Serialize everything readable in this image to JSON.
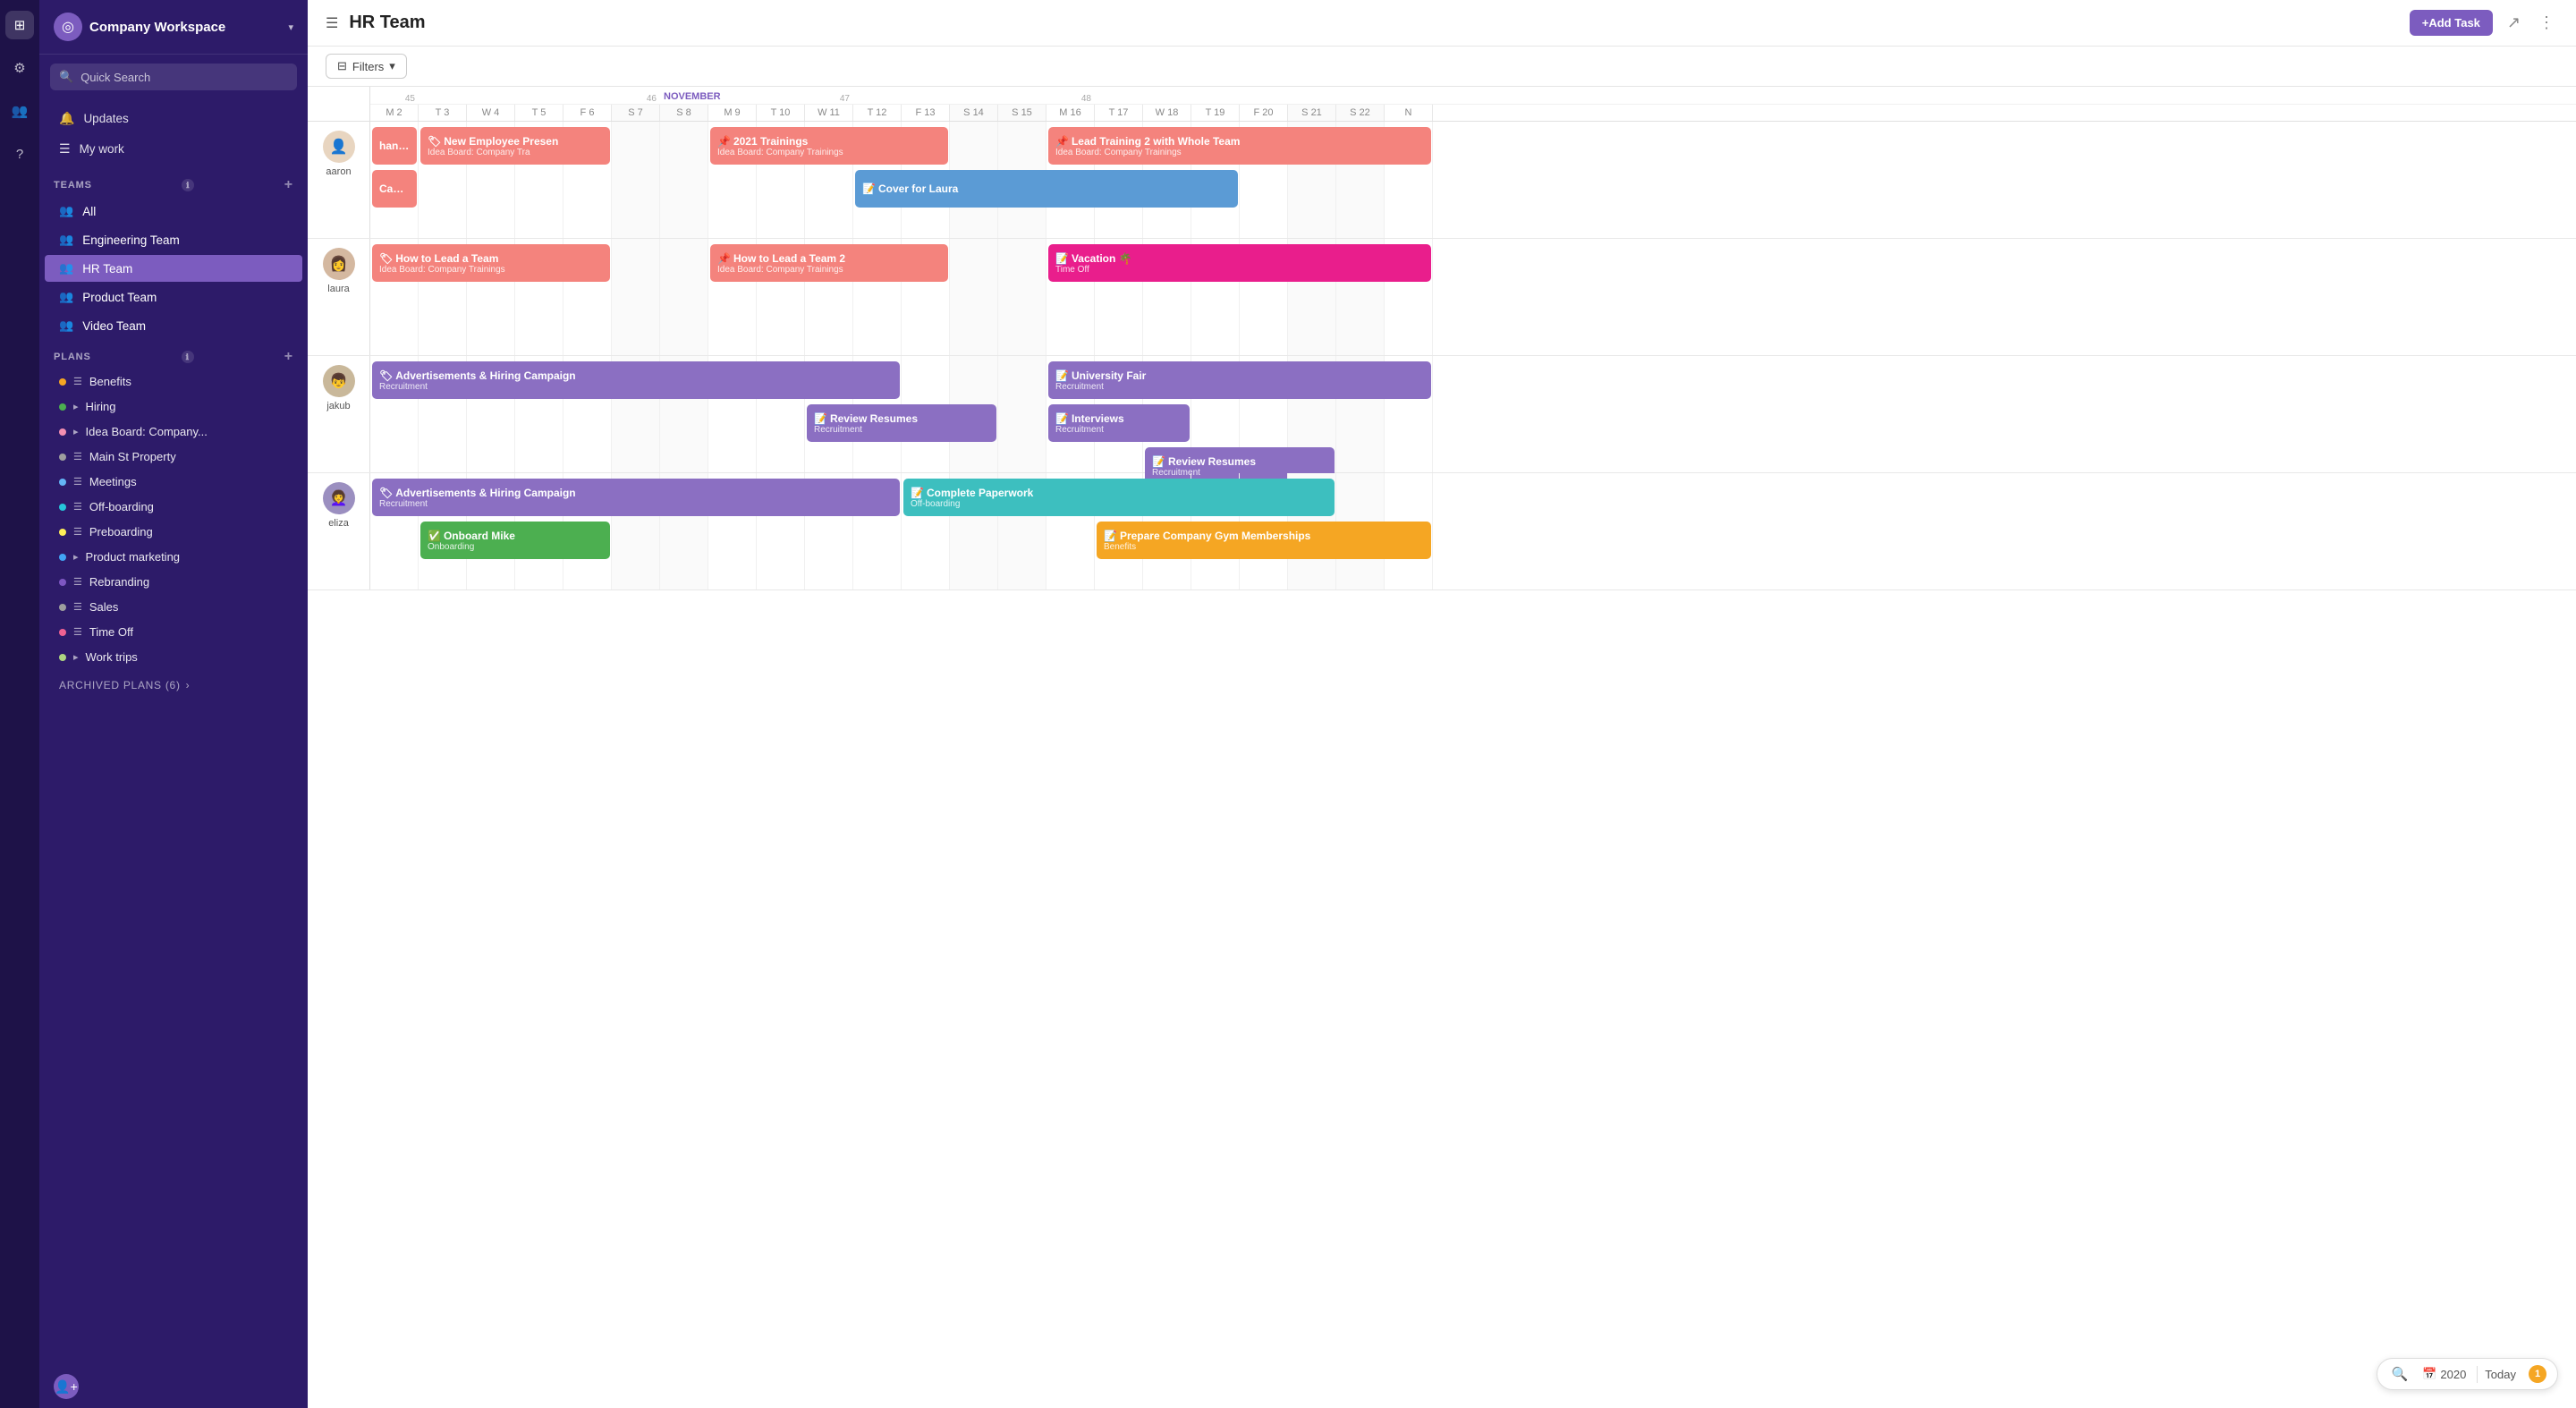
{
  "sidebar": {
    "workspace_label": "Company Workspace",
    "search_placeholder": "Quick Search",
    "nav_items": [
      {
        "id": "updates",
        "label": "Updates",
        "icon": "🔔"
      },
      {
        "id": "my-work",
        "label": "My work",
        "icon": "☰"
      }
    ],
    "teams_section": "TEAMS",
    "teams": [
      {
        "id": "all",
        "label": "All"
      },
      {
        "id": "engineering",
        "label": "Engineering Team"
      },
      {
        "id": "hr",
        "label": "HR Team",
        "active": true
      },
      {
        "id": "product",
        "label": "Product Team"
      },
      {
        "id": "video",
        "label": "Video Team"
      }
    ],
    "plans_section": "PLANS",
    "plans": [
      {
        "id": "benefits",
        "label": "Benefits",
        "dot_color": "#f5a623",
        "type": "rows"
      },
      {
        "id": "hiring",
        "label": "Hiring",
        "dot_color": "#4caf50",
        "type": "arrow"
      },
      {
        "id": "idea-board",
        "label": "Idea Board: Company...",
        "dot_color": "#f48fb1",
        "type": "arrow"
      },
      {
        "id": "main-st",
        "label": "Main St Property",
        "dot_color": "#9e9e9e",
        "type": "rows"
      },
      {
        "id": "meetings",
        "label": "Meetings",
        "dot_color": "#64b5f6",
        "type": "rows"
      },
      {
        "id": "offboarding",
        "label": "Off-boarding",
        "dot_color": "#26c6da",
        "type": "rows"
      },
      {
        "id": "preboarding",
        "label": "Preboarding",
        "dot_color": "#ffee58",
        "type": "rows"
      },
      {
        "id": "product-marketing",
        "label": "Product marketing",
        "dot_color": "#42a5f5",
        "type": "arrow"
      },
      {
        "id": "rebranding",
        "label": "Rebranding",
        "dot_color": "#7e57c2",
        "type": "rows"
      },
      {
        "id": "sales",
        "label": "Sales",
        "dot_color": "#9e9e9e",
        "type": "rows"
      },
      {
        "id": "time-off",
        "label": "Time Off",
        "dot_color": "#f06292",
        "type": "rows"
      },
      {
        "id": "work-trips",
        "label": "Work trips",
        "dot_color": "#aed581",
        "type": "arrow"
      }
    ],
    "archived_label": "ARCHIVED PLANS (6)"
  },
  "topbar": {
    "title": "HR Team",
    "add_btn_label": "+Add Task",
    "menu_icon": "☰",
    "share_icon": "↑",
    "more_icon": "⋮"
  },
  "filterbar": {
    "filter_btn_label": "Filters",
    "filter_icon": "▾"
  },
  "calendar": {
    "week_num_45": "45",
    "week_num_46": "46",
    "week_num_47": "47",
    "week_num_48": "48",
    "month_november": "NOVEMBER",
    "days": [
      {
        "label": "M 2",
        "col": 1
      },
      {
        "label": "T 3",
        "col": 2
      },
      {
        "label": "W 4",
        "col": 3
      },
      {
        "label": "T 5",
        "col": 4
      },
      {
        "label": "F 6",
        "col": 5
      },
      {
        "label": "S 7",
        "col": 6
      },
      {
        "label": "S 8",
        "col": 7
      },
      {
        "label": "M 9",
        "col": 8
      },
      {
        "label": "T 10",
        "col": 9
      },
      {
        "label": "W 11",
        "col": 10
      },
      {
        "label": "T 12",
        "col": 11
      },
      {
        "label": "F 13",
        "col": 12
      },
      {
        "label": "S 14",
        "col": 13
      },
      {
        "label": "S 15",
        "col": 14
      },
      {
        "label": "M 16",
        "col": 15
      },
      {
        "label": "T 17",
        "col": 16
      },
      {
        "label": "W 18",
        "col": 17
      },
      {
        "label": "T 19",
        "col": 18
      },
      {
        "label": "F 20",
        "col": 19
      },
      {
        "label": "S 21",
        "col": 20
      },
      {
        "label": "S 22",
        "col": 21
      },
      {
        "label": "N",
        "col": 22
      }
    ],
    "people": [
      {
        "id": "aaron",
        "name": "aaron",
        "avatar_emoji": "👤",
        "events": [
          {
            "id": "e1",
            "title": "handbook",
            "sub": "",
            "col_start": 1,
            "col_span": 1,
            "color": "ev-salmon",
            "icon": "",
            "row": 1
          },
          {
            "id": "e2",
            "title": "New Employee Presen",
            "sub": "Idea Board: Company Tra",
            "col_start": 2,
            "col_span": 4,
            "color": "ev-salmon",
            "icon": "🏷",
            "row": 1
          },
          {
            "id": "e3",
            "title": "2021 Trainings",
            "sub": "Idea Board: Company Trainings",
            "col_start": 8,
            "col_span": 5,
            "color": "ev-salmon",
            "icon": "📌",
            "row": 1
          },
          {
            "id": "e4",
            "title": "Lead Training 2 with Whole Team",
            "sub": "Idea Board: Company Trainings",
            "col_start": 15,
            "col_span": 8,
            "color": "ev-salmon",
            "icon": "📌",
            "row": 1
          },
          {
            "id": "e5",
            "title": "Campus",
            "sub": "",
            "col_start": 1,
            "col_span": 1,
            "color": "ev-salmon",
            "icon": "",
            "row": 2
          },
          {
            "id": "e6",
            "title": "Cover for Laura",
            "sub": "",
            "col_start": 11,
            "col_span": 8,
            "color": "ev-blue",
            "icon": "📝",
            "row": 2
          }
        ]
      },
      {
        "id": "laura",
        "name": "laura",
        "avatar_emoji": "👩",
        "events": [
          {
            "id": "e7",
            "title": "How to Lead a Team",
            "sub": "Idea Board: Company Trainings",
            "col_start": 1,
            "col_span": 5,
            "color": "ev-salmon",
            "icon": "🏷",
            "row": 1
          },
          {
            "id": "e8",
            "title": "How to Lead a Team 2",
            "sub": "Idea Board: Company Trainings",
            "col_start": 8,
            "col_span": 5,
            "color": "ev-salmon",
            "icon": "📌",
            "row": 1
          },
          {
            "id": "e9",
            "title": "Vacation 🌴",
            "sub": "Time Off",
            "col_start": 15,
            "col_span": 8,
            "color": "ev-pink",
            "icon": "📝",
            "row": 1
          }
        ]
      },
      {
        "id": "jakub",
        "name": "jakub",
        "avatar_emoji": "👦",
        "events": [
          {
            "id": "e10",
            "title": "Advertisements & Hiring Campaign",
            "sub": "Recruitment",
            "col_start": 1,
            "col_span": 11,
            "color": "ev-purple",
            "icon": "🏷",
            "row": 1
          },
          {
            "id": "e11",
            "title": "University Fair",
            "sub": "Recruitment",
            "col_start": 15,
            "col_span": 8,
            "color": "ev-purple",
            "icon": "📝",
            "row": 1
          },
          {
            "id": "e12",
            "title": "Review Resumes",
            "sub": "Recruitment",
            "col_start": 10,
            "col_span": 4,
            "color": "ev-purple",
            "icon": "📝",
            "row": 2
          },
          {
            "id": "e13",
            "title": "Interviews",
            "sub": "Recruitment",
            "col_start": 15,
            "col_span": 3,
            "color": "ev-purple",
            "icon": "📝",
            "row": 2
          },
          {
            "id": "e14",
            "title": "Review Resumes",
            "sub": "Recruitment",
            "col_start": 17,
            "col_span": 4,
            "color": "ev-purple",
            "icon": "📝",
            "row": 3
          }
        ]
      },
      {
        "id": "eliza",
        "name": "eliza",
        "avatar_emoji": "👩‍🦱",
        "events": [
          {
            "id": "e15",
            "title": "Advertisements & Hiring Campaign",
            "sub": "Recruitment",
            "col_start": 1,
            "col_span": 11,
            "color": "ev-purple",
            "icon": "🏷",
            "row": 1
          },
          {
            "id": "e16",
            "title": "Complete Paperwork",
            "sub": "Off-boarding",
            "col_start": 12,
            "col_span": 9,
            "color": "ev-teal",
            "icon": "📝",
            "row": 1
          },
          {
            "id": "e17",
            "title": "Onboard Mike",
            "sub": "Onboarding",
            "col_start": 2,
            "col_span": 4,
            "color": "ev-green",
            "icon": "✅",
            "row": 2
          },
          {
            "id": "e18",
            "title": "Prepare Company Gym Memberships",
            "sub": "Benefits",
            "col_start": 16,
            "col_span": 7,
            "color": "ev-orange",
            "icon": "📝",
            "row": 2
          }
        ]
      }
    ]
  },
  "bottom_toolbar": {
    "zoom_icon": "🔍",
    "calendar_icon": "📅",
    "year_label": "2020",
    "today_label": "Today",
    "notification_count": "1"
  }
}
